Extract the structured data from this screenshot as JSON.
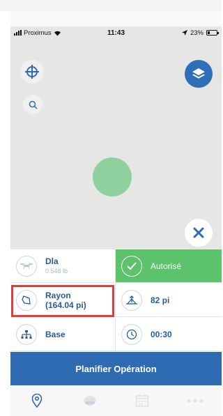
{
  "status_bar": {
    "carrier": "Proximus",
    "time": "11:43",
    "battery": "23%"
  },
  "map": {
    "zone_color": "#8fd19e"
  },
  "tiles": {
    "drone": {
      "name": "Dla",
      "weight": "0.548 lb"
    },
    "authorization": {
      "label": "Autorisé"
    },
    "radius": {
      "line1": "Rayon",
      "line2": "(164.04 pi)"
    },
    "altitude": {
      "label": "82 pi"
    },
    "base": {
      "label": "Base"
    },
    "duration": {
      "label": "00:30"
    }
  },
  "plan_button": {
    "label": "Planifier Opération"
  },
  "tabbar": {
    "tabs": [
      {
        "icon": "location-pin-icon",
        "active": true
      },
      {
        "icon": "helmet-icon",
        "active": false
      },
      {
        "icon": "calendar-icon",
        "active": false
      },
      {
        "icon": "more-dots-icon",
        "active": false
      }
    ]
  },
  "colors": {
    "primary": "#2f6bb3",
    "success": "#5cc26b",
    "highlight": "#e23b3b"
  }
}
